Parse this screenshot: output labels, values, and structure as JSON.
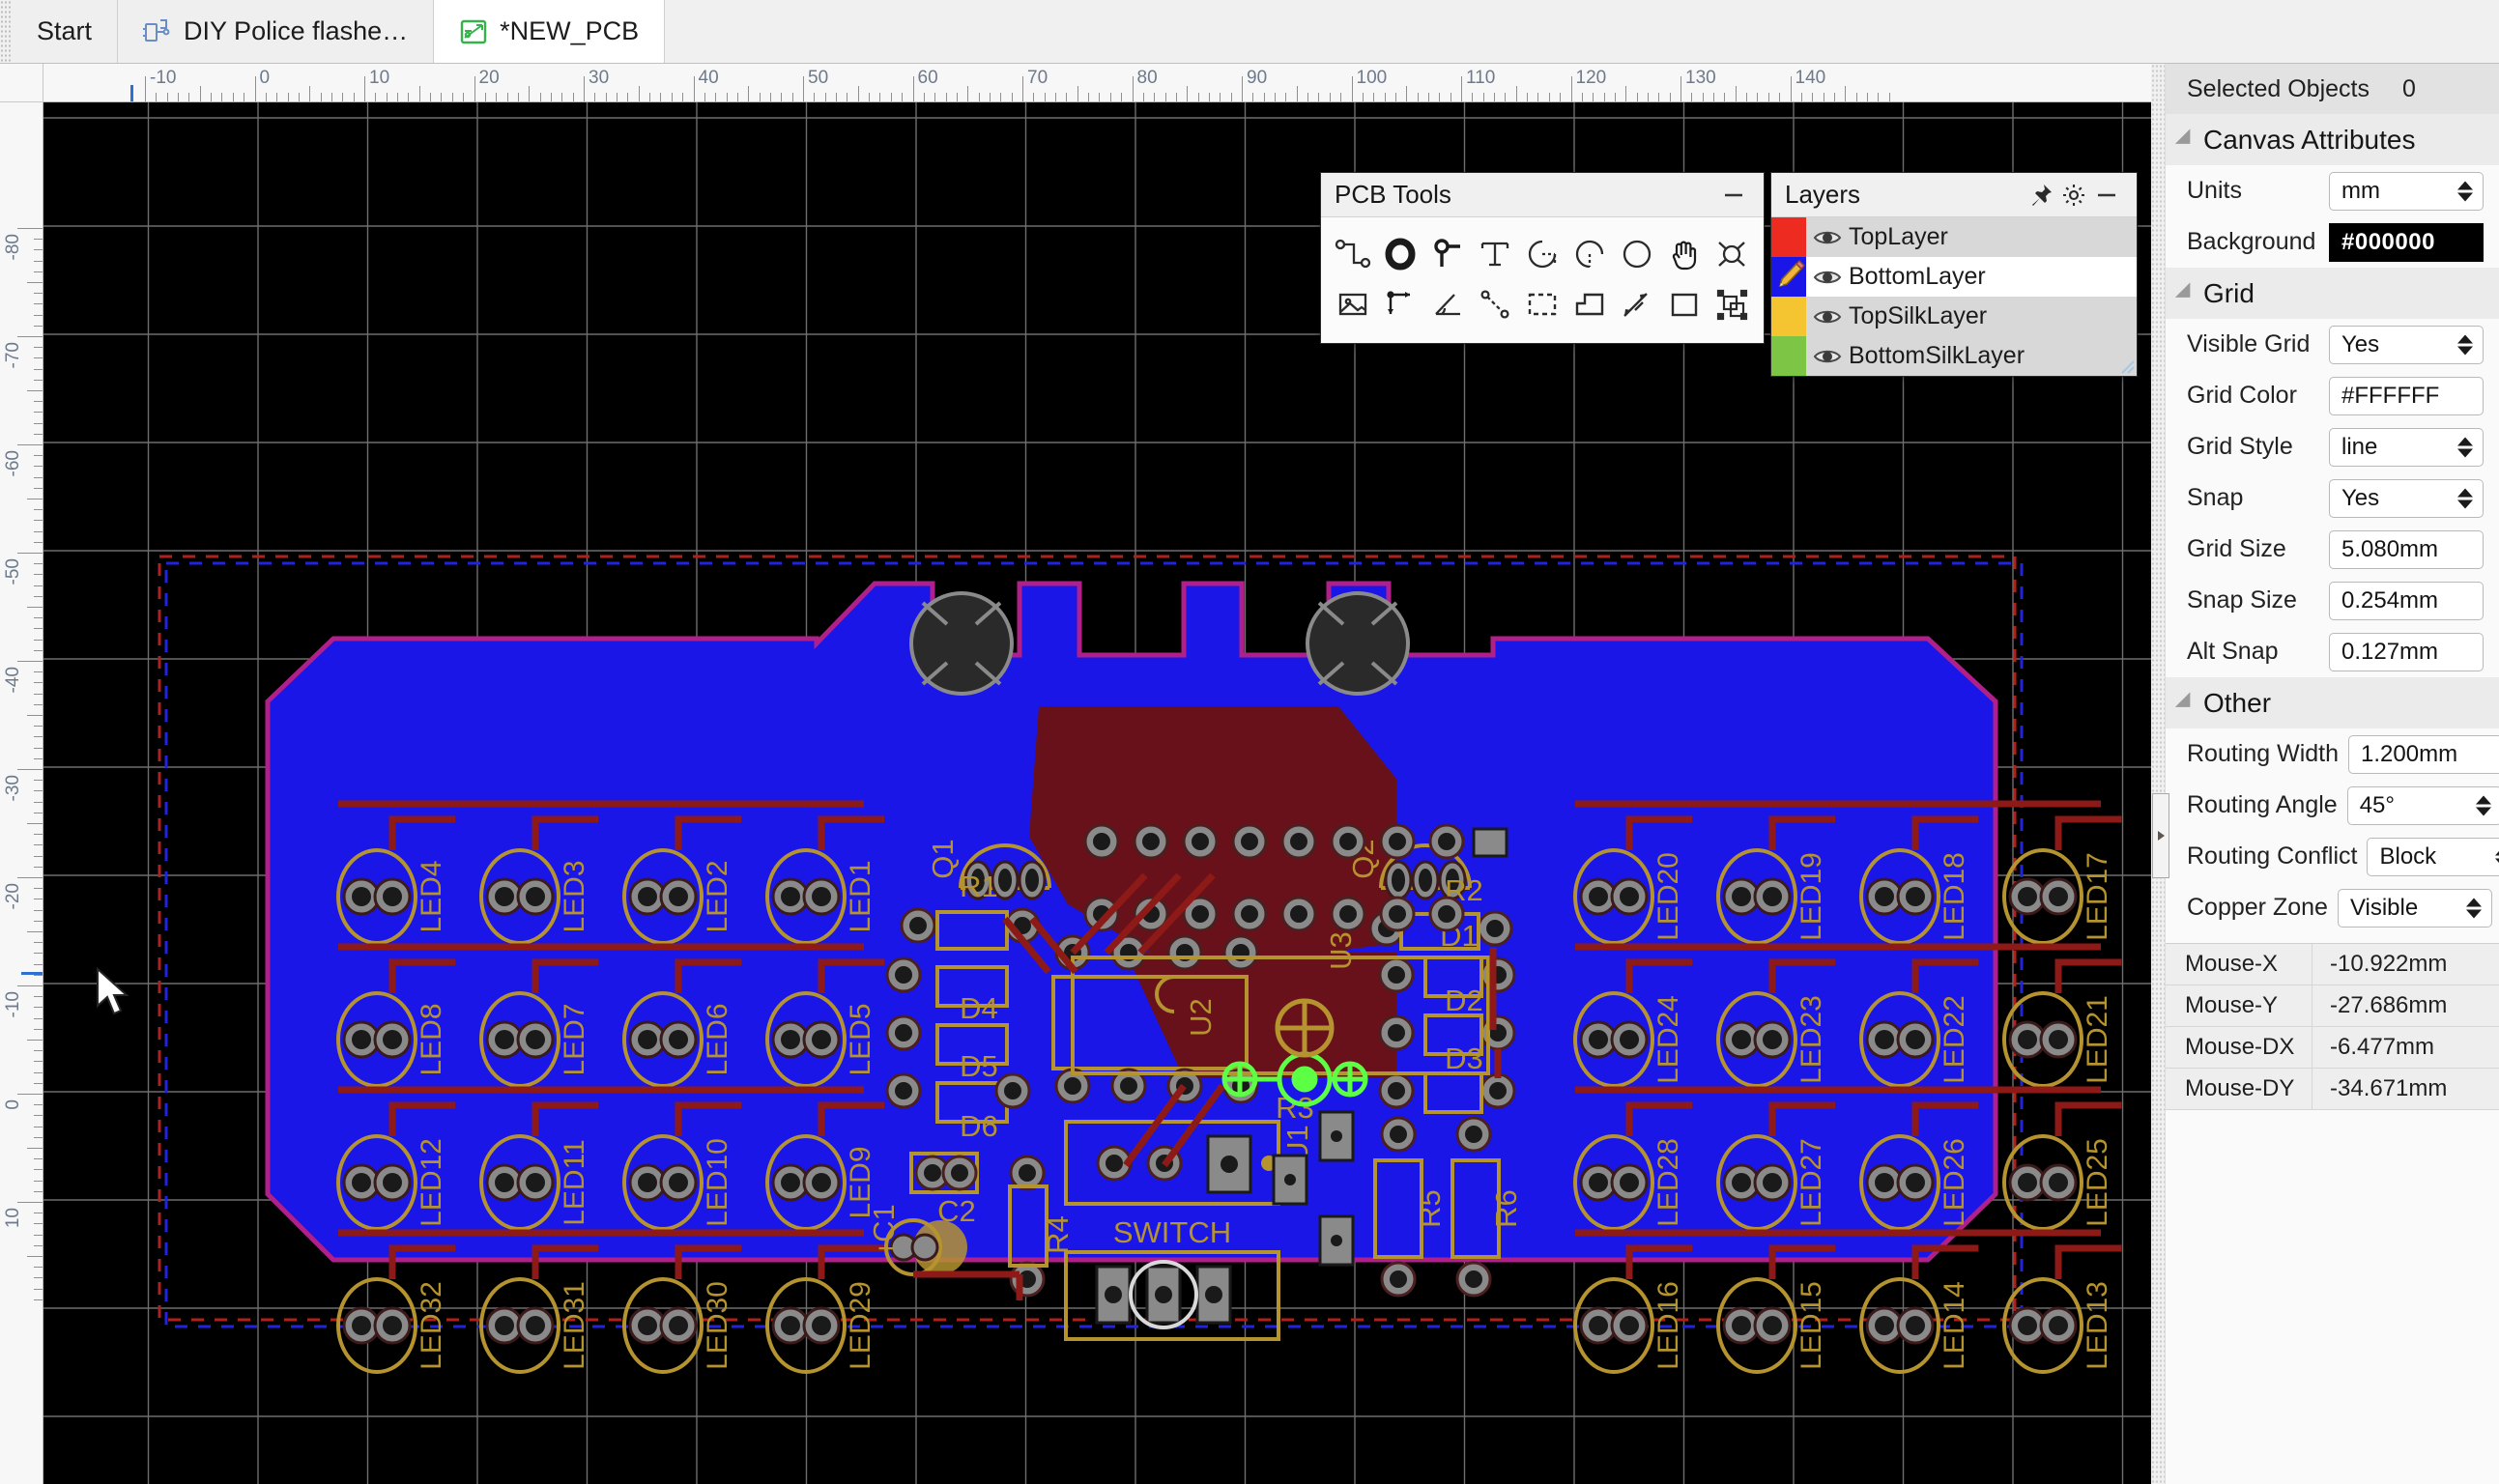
{
  "tabs": [
    {
      "label": "Start",
      "icon": "none",
      "active": false
    },
    {
      "label": "DIY Police flashe…",
      "icon": "schematic-icon",
      "active": false
    },
    {
      "label": "*NEW_PCB",
      "icon": "pcb-icon",
      "active": true
    }
  ],
  "rulers": {
    "horizontal": {
      "labels": [
        "-10",
        "0",
        "10",
        "20",
        "30",
        "40",
        "50",
        "60",
        "70",
        "80",
        "90",
        "100",
        "110",
        "120",
        "130",
        "140"
      ],
      "cursor_value": -10.922
    },
    "vertical": {
      "labels": [
        "-80",
        "-70",
        "-60",
        "-50",
        "-40",
        "-30",
        "-20",
        "-10",
        "0",
        "10"
      ],
      "cursor_value": -27.686
    }
  },
  "pcb_tools": {
    "title": "PCB Tools",
    "minimize_label": "—",
    "tools": [
      {
        "name": "track-icon"
      },
      {
        "name": "pad-icon"
      },
      {
        "name": "via-icon"
      },
      {
        "name": "text-icon"
      },
      {
        "name": "arc-3point-icon"
      },
      {
        "name": "arc-center-icon"
      },
      {
        "name": "circle-icon"
      },
      {
        "name": "hand-pan-icon"
      },
      {
        "name": "hole-icon"
      },
      {
        "name": "image-icon"
      },
      {
        "name": "axis-icon"
      },
      {
        "name": "angle-icon"
      },
      {
        "name": "polyline-icon"
      },
      {
        "name": "dashed-rect-icon"
      },
      {
        "name": "solid-region-icon"
      },
      {
        "name": "dimension-icon"
      },
      {
        "name": "rect-icon"
      },
      {
        "name": "group-select-icon"
      }
    ]
  },
  "layers_panel": {
    "title": "Layers",
    "pin_label": "pin",
    "settings_label": "settings",
    "minimize_label": "—",
    "layers": [
      {
        "name": "TopLayer",
        "color": "#ee2b21",
        "selected": false,
        "visible": true
      },
      {
        "name": "BottomLayer",
        "color": "#1a16e8",
        "selected": true,
        "visible": true
      },
      {
        "name": "TopSilkLayer",
        "color": "#f5c431",
        "selected": false,
        "visible": true
      },
      {
        "name": "BottomSilkLayer",
        "color": "#7dc544",
        "selected": false,
        "visible": true
      }
    ]
  },
  "properties": {
    "selected_objects_label": "Selected Objects",
    "selected_objects_value": "0",
    "groups": [
      {
        "title": "Canvas Attributes",
        "rows": [
          {
            "label": "Units",
            "value": "mm",
            "type": "select"
          },
          {
            "label": "Background",
            "value": "#000000",
            "type": "color"
          }
        ]
      },
      {
        "title": "Grid",
        "rows": [
          {
            "label": "Visible Grid",
            "value": "Yes",
            "type": "select"
          },
          {
            "label": "Grid Color",
            "value": "#FFFFFF",
            "type": "text"
          },
          {
            "label": "Grid Style",
            "value": "line",
            "type": "select"
          },
          {
            "label": "Snap",
            "value": "Yes",
            "type": "select"
          },
          {
            "label": "Grid Size",
            "value": "5.080mm",
            "type": "text"
          },
          {
            "label": "Snap Size",
            "value": "0.254mm",
            "type": "text"
          },
          {
            "label": "Alt Snap",
            "value": "0.127mm",
            "type": "text"
          }
        ]
      },
      {
        "title": "Other",
        "rows": [
          {
            "label": "Routing Width",
            "value": "1.200mm",
            "type": "text"
          },
          {
            "label": "Routing Angle",
            "value": "45°",
            "type": "select"
          },
          {
            "label": "Routing Conflict",
            "value": "Block",
            "type": "select"
          },
          {
            "label": "Copper Zone",
            "value": "Visible",
            "type": "select"
          }
        ]
      }
    ],
    "mouse": [
      {
        "label": "Mouse-X",
        "value": "-10.922mm"
      },
      {
        "label": "Mouse-Y",
        "value": "-27.686mm"
      },
      {
        "label": "Mouse-DX",
        "value": "-6.477mm"
      },
      {
        "label": "Mouse-DY",
        "value": "-34.671mm"
      }
    ]
  },
  "board": {
    "copper_color": "#1a16e8",
    "silk_color": "#b5932f",
    "track_color": "#8e1a18",
    "outline_color": "#b0208a",
    "pad_ring": "#8a8a8a",
    "pad_hole": "#1a1a1a",
    "zone_color": "#6e1110",
    "led_left": [
      [
        "LED4",
        "LED3",
        "LED2",
        "LED1"
      ],
      [
        "LED8",
        "LED7",
        "LED6",
        "LED5"
      ],
      [
        "LED12",
        "LED11",
        "LED10",
        "LED9"
      ],
      [
        "LED32",
        "LED31",
        "LED30",
        "LED29"
      ]
    ],
    "led_right": [
      [
        "LED20",
        "LED19",
        "LED18",
        "LED17"
      ],
      [
        "LED24",
        "LED23",
        "LED22",
        "LED21"
      ],
      [
        "LED28",
        "LED27",
        "LED26",
        "LED25"
      ],
      [
        "LED16",
        "LED15",
        "LED14",
        "LED13"
      ]
    ],
    "designators": [
      "Q1",
      "Q2",
      "R1",
      "R2",
      "R3",
      "R4",
      "R5",
      "R6",
      "D1",
      "D2",
      "D3",
      "D4",
      "D5",
      "D6",
      "C1",
      "C2",
      "U1",
      "U2",
      "U3",
      "SWITCH",
      "+"
    ]
  }
}
